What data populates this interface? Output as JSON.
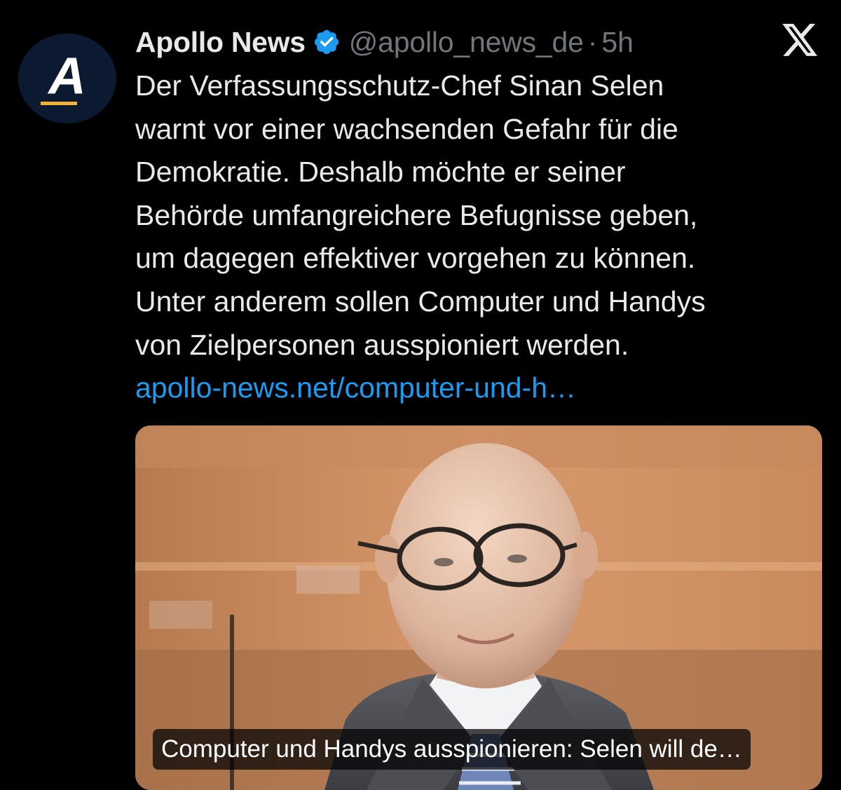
{
  "author": {
    "display_name": "Apollo News",
    "handle": "@apollo_news_de",
    "separator": "·",
    "time": "5h",
    "avatar_letter": "A",
    "verified": true
  },
  "tweet": {
    "lines": [
      "Der Verfassungsschutz-Chef Sinan Selen",
      "warnt vor einer wachsenden Gefahr für die",
      "Demokratie. Deshalb möchte er seiner",
      "Behörde umfangreichere Befugnisse geben,",
      "um dagegen effektiver vorgehen zu können.",
      "Unter anderem sollen Computer und Handys",
      "von Zielpersonen ausspioniert werden."
    ],
    "link": "apollo-news.net/computer-und-h…"
  },
  "media": {
    "caption": "Computer und Handys ausspionieren: Selen will de…"
  },
  "icons": {
    "verified": "verified-badge-icon",
    "platform": "x-logo-icon"
  },
  "colors": {
    "background": "#000000",
    "text": "#e7e9ea",
    "muted": "#71767b",
    "link": "#1d9bf0",
    "verified": "#1d9bf0",
    "avatar_bg": "#0b1a30",
    "avatar_accent": "#f2b233"
  }
}
